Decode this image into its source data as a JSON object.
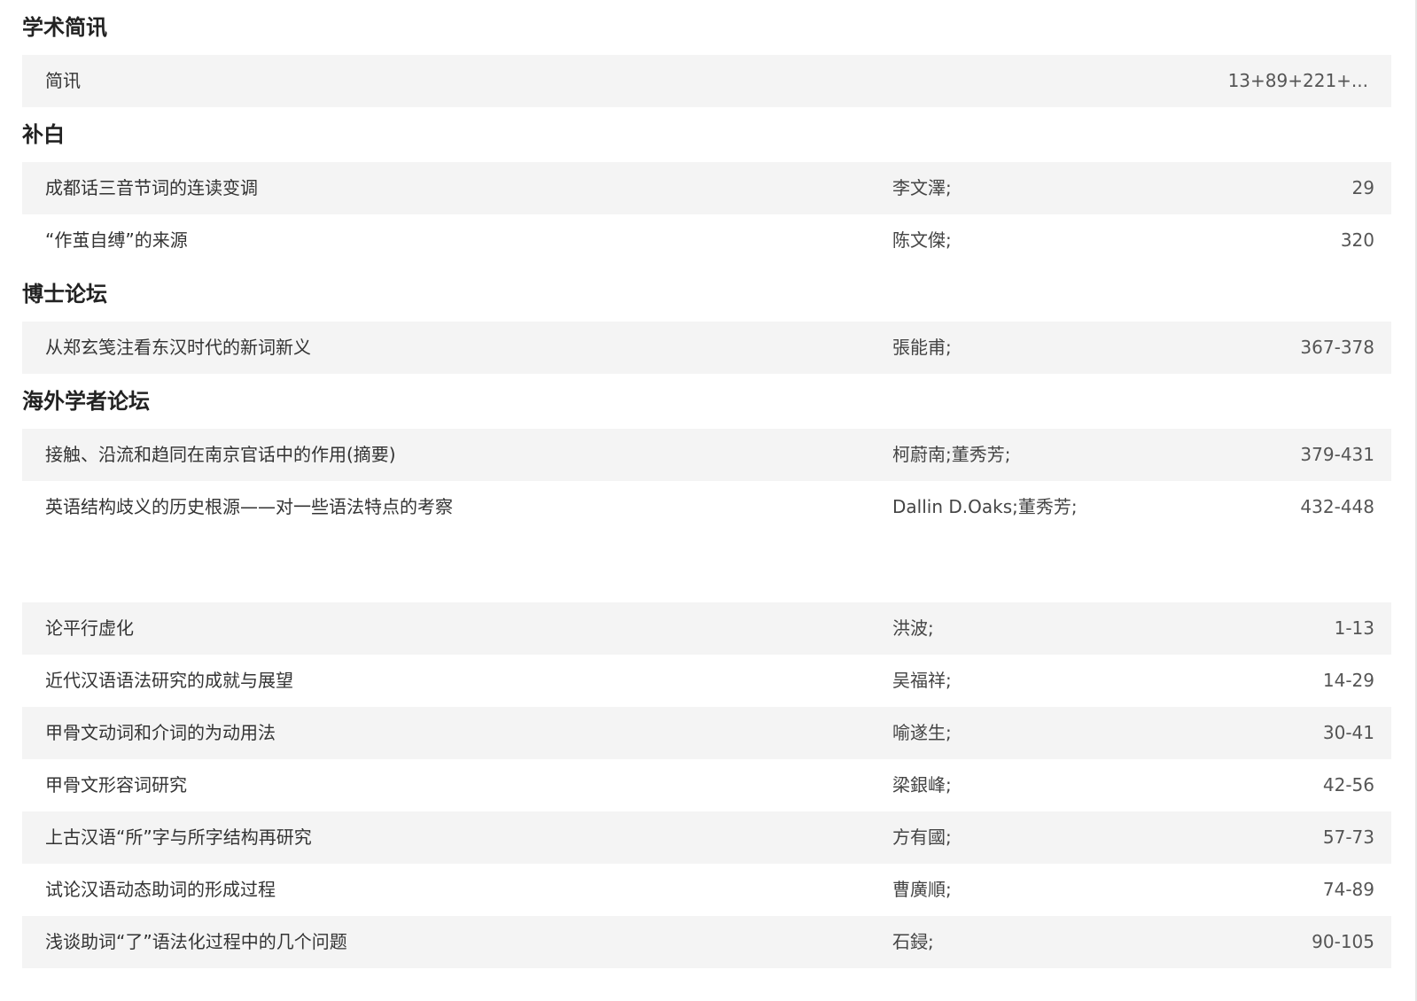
{
  "sections": [
    {
      "title": "学术简讯",
      "rows": [
        {
          "title": "简讯",
          "author": "",
          "pages": "13+89+221+..."
        }
      ]
    },
    {
      "title": "补白",
      "rows": [
        {
          "title": "成都话三音节词的连读变调",
          "author": "李文澤;",
          "pages": "29"
        },
        {
          "title": "“作茧自缚”的来源",
          "author": "陈文傑;",
          "pages": "320"
        }
      ]
    },
    {
      "title": "博士论坛",
      "rows": [
        {
          "title": "从郑玄笺注看东汉时代的新词新义",
          "author": "張能甫;",
          "pages": "367-378"
        }
      ]
    },
    {
      "title": "海外学者论坛",
      "rows": [
        {
          "title": "接触、沿流和趋同在南京官话中的作用(摘要)",
          "author": "柯蔚南;董秀芳;",
          "pages": "379-431"
        },
        {
          "title": "英语结构歧义的历史根源——对一些语法特点的考察",
          "author": "Dallin D.Oaks;董秀芳;",
          "pages": "432-448"
        }
      ]
    }
  ],
  "untitled_rows": [
    {
      "title": "论平行虚化",
      "author": "洪波;",
      "pages": "1-13"
    },
    {
      "title": "近代汉语语法研究的成就与展望",
      "author": "吴福祥;",
      "pages": "14-29"
    },
    {
      "title": "甲骨文动词和介词的为动用法",
      "author": "喻遂生;",
      "pages": "30-41"
    },
    {
      "title": "甲骨文形容词研究",
      "author": "梁銀峰;",
      "pages": "42-56"
    },
    {
      "title": "上古汉语“所”字与所字结构再研究",
      "author": "方有國;",
      "pages": "57-73"
    },
    {
      "title": "试论汉语动态助词的形成过程",
      "author": "曹廣順;",
      "pages": "74-89"
    },
    {
      "title": "浅谈助词“了”语法化过程中的几个问题",
      "author": "石鋟;",
      "pages": "90-105"
    }
  ],
  "colors": {
    "row_shade": "#f4f4f4",
    "text": "#333333",
    "heading": "#222222"
  }
}
